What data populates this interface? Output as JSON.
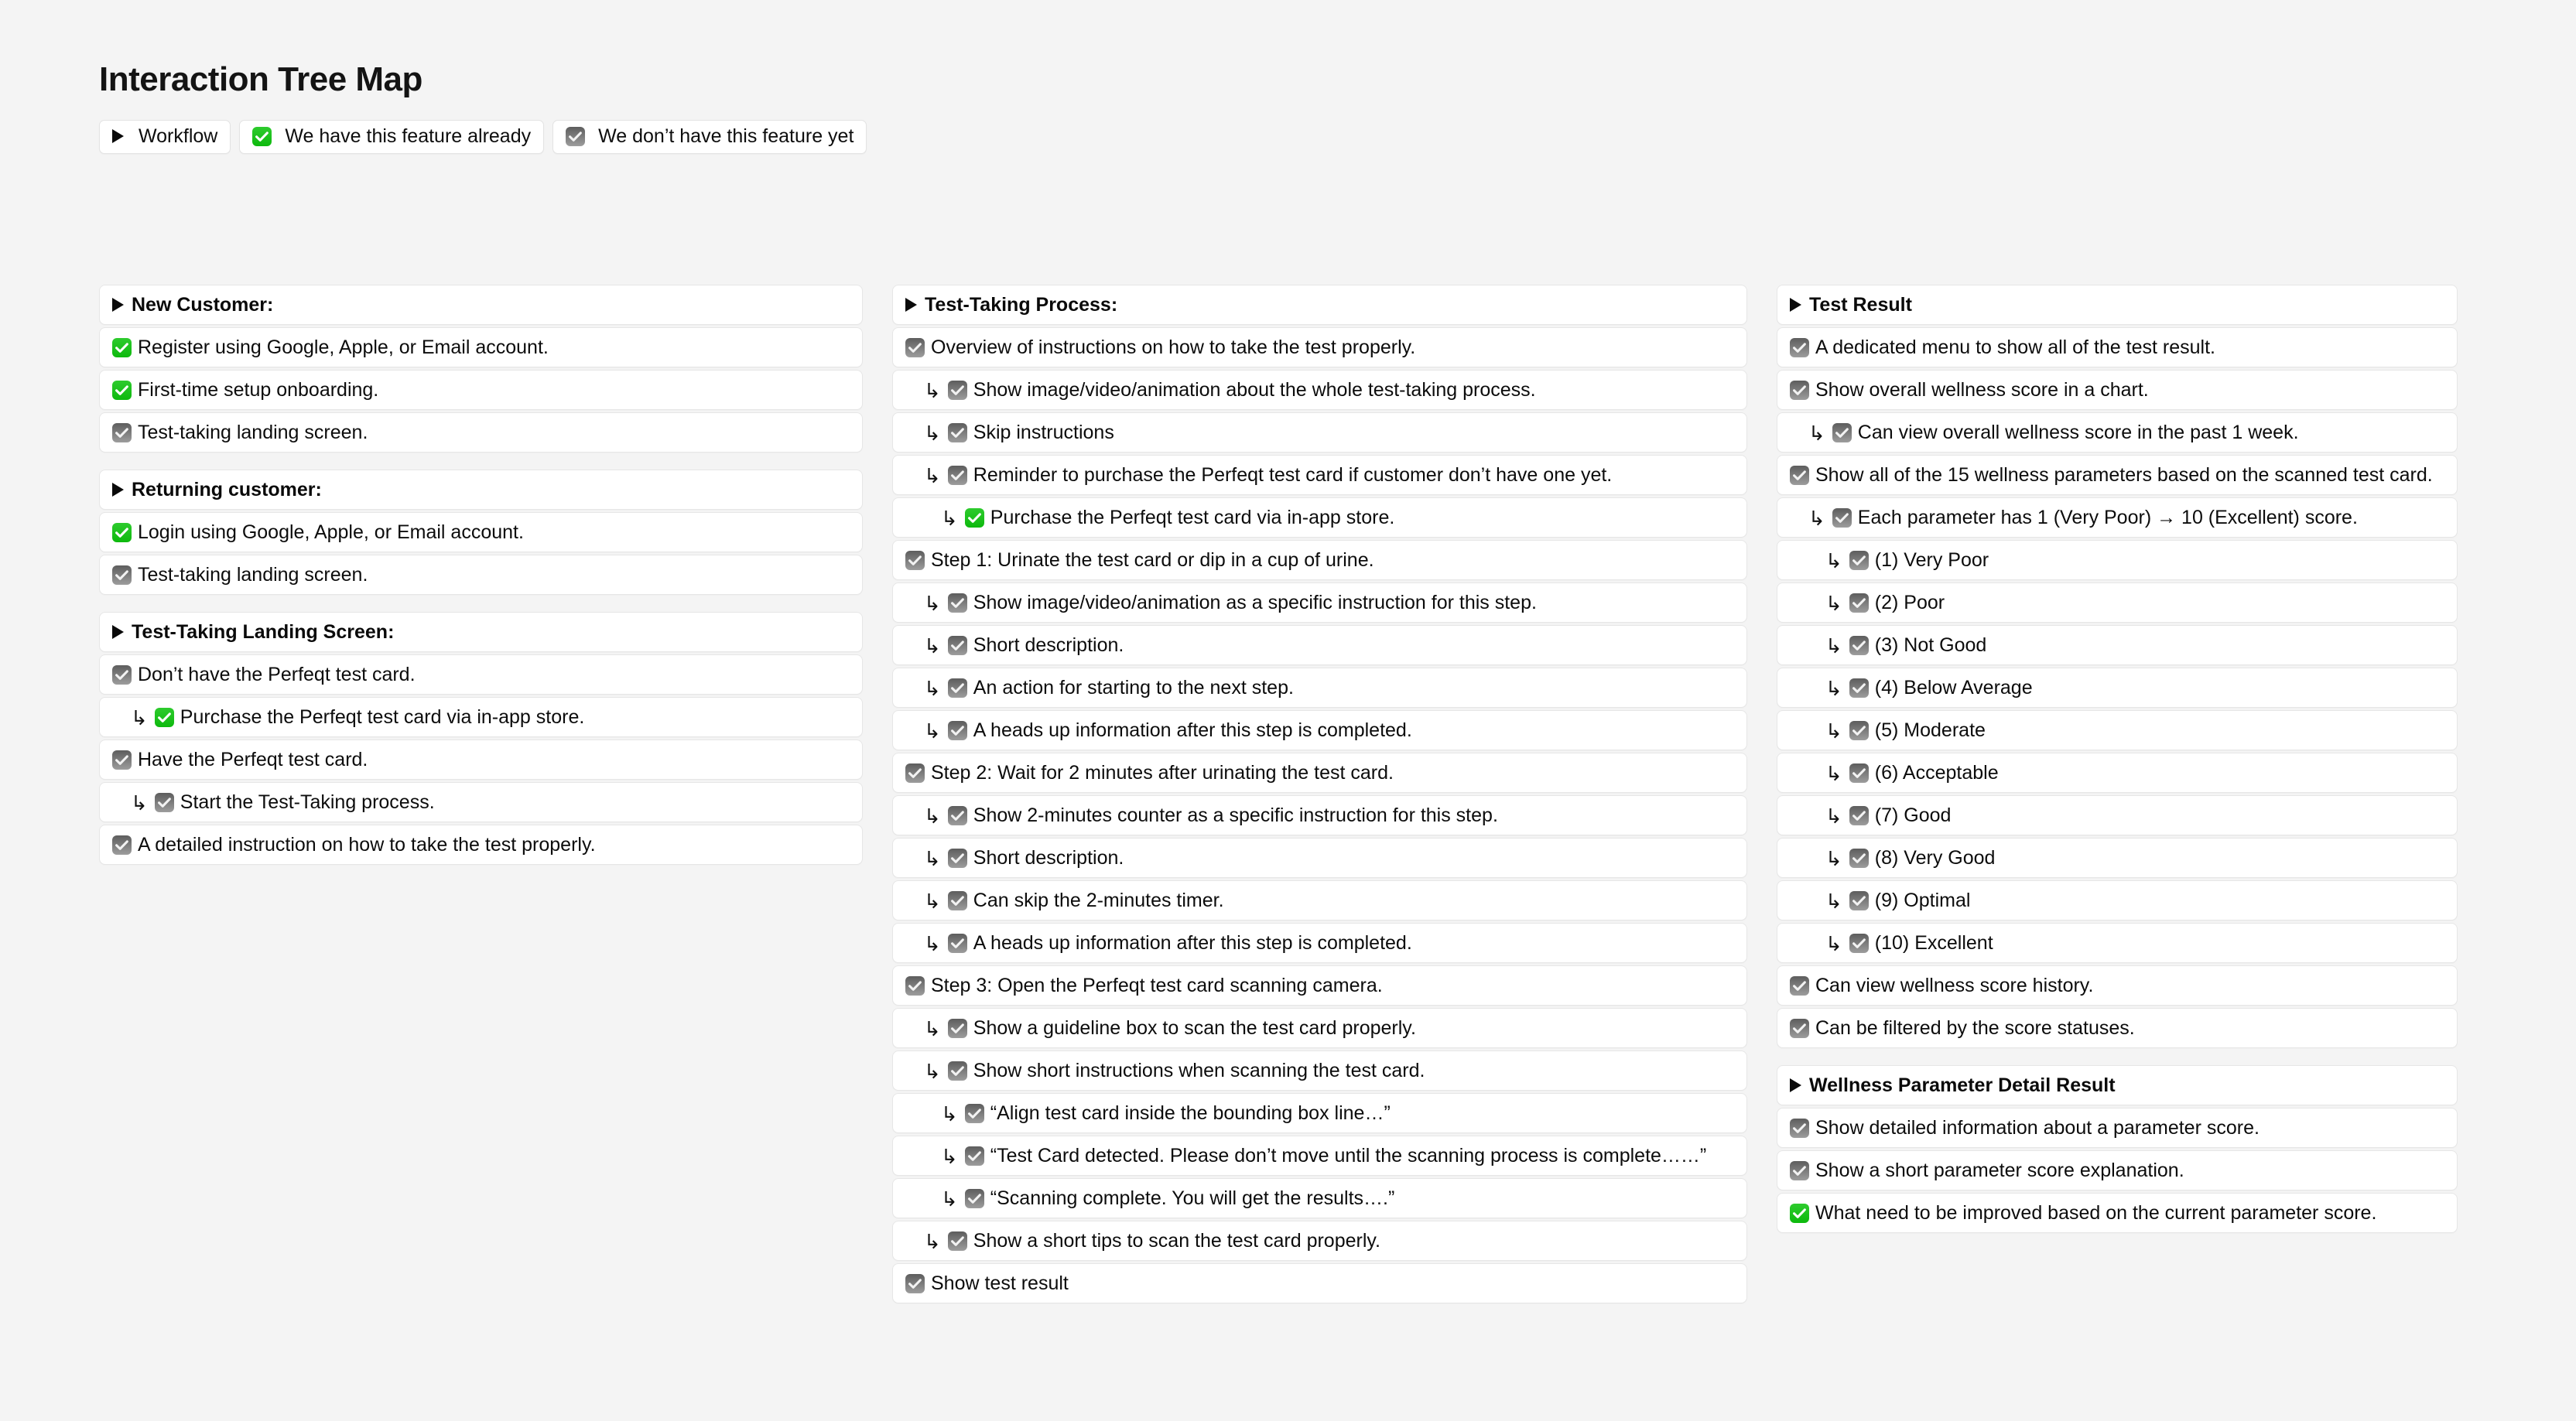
{
  "header": {
    "title": "Interaction Tree Map",
    "legend": [
      {
        "icon": "workflow-triangle",
        "label": "Workflow"
      },
      {
        "icon": "green-check",
        "label": "We have this feature already"
      },
      {
        "icon": "gray-check",
        "label": "We don’t have this feature yet"
      }
    ]
  },
  "columns": [
    {
      "id": "col-new-customer",
      "rows": [
        {
          "icon": "workflow-triangle",
          "indent": 0,
          "label": "New Customer:",
          "heading": true
        },
        {
          "icon": "green-check",
          "indent": 0,
          "label": "Register using Google, Apple, or Email account."
        },
        {
          "icon": "green-check",
          "indent": 0,
          "label": "First-time setup onboarding."
        },
        {
          "icon": "gray-check",
          "indent": 0,
          "label": "Test-taking landing screen."
        },
        {
          "icon": "workflow-triangle",
          "indent": 0,
          "label": "Returning customer:",
          "heading": true,
          "group_gap": true
        },
        {
          "icon": "green-check",
          "indent": 0,
          "label": "Login using Google, Apple, or Email account."
        },
        {
          "icon": "gray-check",
          "indent": 0,
          "label": "Test-taking landing screen."
        },
        {
          "icon": "workflow-triangle",
          "indent": 0,
          "label": "Test-Taking Landing Screen:",
          "heading": true,
          "group_gap": true
        },
        {
          "icon": "gray-check",
          "indent": 0,
          "label": "Don’t have the Perfeqt test card."
        },
        {
          "icon": "green-check",
          "indent": 1,
          "arrow": true,
          "label": "Purchase the Perfeqt test card via in-app store."
        },
        {
          "icon": "gray-check",
          "indent": 0,
          "label": "Have the Perfeqt test card."
        },
        {
          "icon": "gray-check",
          "indent": 1,
          "arrow": true,
          "label": "Start the Test-Taking process."
        },
        {
          "icon": "gray-check",
          "indent": 0,
          "label": "A detailed instruction on how to take the test properly."
        }
      ]
    },
    {
      "id": "col-test-taking-process",
      "rows": [
        {
          "icon": "workflow-triangle",
          "indent": 0,
          "label": "Test-Taking Process:",
          "heading": true
        },
        {
          "icon": "gray-check",
          "indent": 0,
          "label": "Overview of instructions on how to take the test properly."
        },
        {
          "icon": "gray-check",
          "indent": 1,
          "arrow": true,
          "label": "Show image/video/animation about the whole test-taking process."
        },
        {
          "icon": "gray-check",
          "indent": 1,
          "arrow": true,
          "label": "Skip instructions"
        },
        {
          "icon": "gray-check",
          "indent": 1,
          "arrow": true,
          "label": "Reminder to purchase the Perfeqt test card if customer don’t have one yet."
        },
        {
          "icon": "green-check",
          "indent": 2,
          "arrow": true,
          "label": "Purchase the Perfeqt test card via in-app store."
        },
        {
          "icon": "gray-check",
          "indent": 0,
          "label": "Step 1: Urinate the test card or dip in a cup of urine."
        },
        {
          "icon": "gray-check",
          "indent": 1,
          "arrow": true,
          "label": "Show image/video/animation as a specific instruction for this step."
        },
        {
          "icon": "gray-check",
          "indent": 1,
          "arrow": true,
          "label": "Short description."
        },
        {
          "icon": "gray-check",
          "indent": 1,
          "arrow": true,
          "label": "An action for starting to the next step."
        },
        {
          "icon": "gray-check",
          "indent": 1,
          "arrow": true,
          "label": "A heads up information after this step is completed."
        },
        {
          "icon": "gray-check",
          "indent": 0,
          "label": "Step 2: Wait for 2 minutes after urinating the test card."
        },
        {
          "icon": "gray-check",
          "indent": 1,
          "arrow": true,
          "label": "Show 2-minutes counter as a specific instruction for this step."
        },
        {
          "icon": "gray-check",
          "indent": 1,
          "arrow": true,
          "label": "Short description."
        },
        {
          "icon": "gray-check",
          "indent": 1,
          "arrow": true,
          "label": "Can skip the 2-minutes timer."
        },
        {
          "icon": "gray-check",
          "indent": 1,
          "arrow": true,
          "label": "A heads up information after this step is completed."
        },
        {
          "icon": "gray-check",
          "indent": 0,
          "label": "Step 3: Open the Perfeqt test card scanning camera."
        },
        {
          "icon": "gray-check",
          "indent": 1,
          "arrow": true,
          "label": "Show a guideline box to scan the test card properly."
        },
        {
          "icon": "gray-check",
          "indent": 1,
          "arrow": true,
          "label": "Show short instructions when scanning the test card."
        },
        {
          "icon": "gray-check",
          "indent": 2,
          "arrow": true,
          "label": "“Align test card inside the bounding box line…”"
        },
        {
          "icon": "gray-check",
          "indent": 2,
          "arrow": true,
          "label": "“Test Card detected. Please don’t move until the scanning process is complete……”"
        },
        {
          "icon": "gray-check",
          "indent": 2,
          "arrow": true,
          "label": "“Scanning complete. You will get the results….”"
        },
        {
          "icon": "gray-check",
          "indent": 1,
          "arrow": true,
          "label": "Show a short tips to scan the test card properly."
        },
        {
          "icon": "gray-check",
          "indent": 0,
          "label": "Show test result"
        }
      ]
    },
    {
      "id": "col-test-result",
      "rows": [
        {
          "icon": "workflow-triangle",
          "indent": 0,
          "label": "Test Result",
          "heading": true
        },
        {
          "icon": "gray-check",
          "indent": 0,
          "label": "A dedicated menu to show all of the test result."
        },
        {
          "icon": "gray-check",
          "indent": 0,
          "label": "Show overall wellness score in a chart."
        },
        {
          "icon": "gray-check",
          "indent": 1,
          "arrow": true,
          "label": "Can view overall wellness score in the past 1 week."
        },
        {
          "icon": "gray-check",
          "indent": 0,
          "label": "Show all of the 15 wellness parameters based on the scanned test card."
        },
        {
          "icon": "gray-check",
          "indent": 1,
          "arrow": true,
          "label": "Each parameter has 1 (Very Poor) → 10 (Excellent) score."
        },
        {
          "icon": "gray-check",
          "indent": 2,
          "arrow": true,
          "label": "(1) Very Poor"
        },
        {
          "icon": "gray-check",
          "indent": 2,
          "arrow": true,
          "label": "(2) Poor"
        },
        {
          "icon": "gray-check",
          "indent": 2,
          "arrow": true,
          "label": "(3) Not Good"
        },
        {
          "icon": "gray-check",
          "indent": 2,
          "arrow": true,
          "label": "(4) Below Average"
        },
        {
          "icon": "gray-check",
          "indent": 2,
          "arrow": true,
          "label": "(5) Moderate"
        },
        {
          "icon": "gray-check",
          "indent": 2,
          "arrow": true,
          "label": "(6) Acceptable"
        },
        {
          "icon": "gray-check",
          "indent": 2,
          "arrow": true,
          "label": "(7) Good"
        },
        {
          "icon": "gray-check",
          "indent": 2,
          "arrow": true,
          "label": "(8) Very Good"
        },
        {
          "icon": "gray-check",
          "indent": 2,
          "arrow": true,
          "label": "(9) Optimal"
        },
        {
          "icon": "gray-check",
          "indent": 2,
          "arrow": true,
          "label": "(10) Excellent"
        },
        {
          "icon": "gray-check",
          "indent": 0,
          "label": "Can view wellness score history."
        },
        {
          "icon": "gray-check",
          "indent": 0,
          "label": "Can be filtered by the score statuses."
        },
        {
          "icon": "workflow-triangle",
          "indent": 0,
          "label": "Wellness Parameter Detail Result",
          "heading": true,
          "group_gap": true
        },
        {
          "icon": "gray-check",
          "indent": 0,
          "label": "Show detailed information about a parameter score."
        },
        {
          "icon": "gray-check",
          "indent": 0,
          "label": "Show a short parameter score explanation."
        },
        {
          "icon": "green-check",
          "indent": 0,
          "label": "What need to be improved based on the current parameter score."
        }
      ]
    }
  ],
  "colors": {
    "background": "#f4f4f4",
    "card": "#ffffff",
    "card_border": "#e6e6e6",
    "green_check": "#0db90d",
    "gray_check": "#7d7d7d",
    "text": "#0c0c0c"
  }
}
